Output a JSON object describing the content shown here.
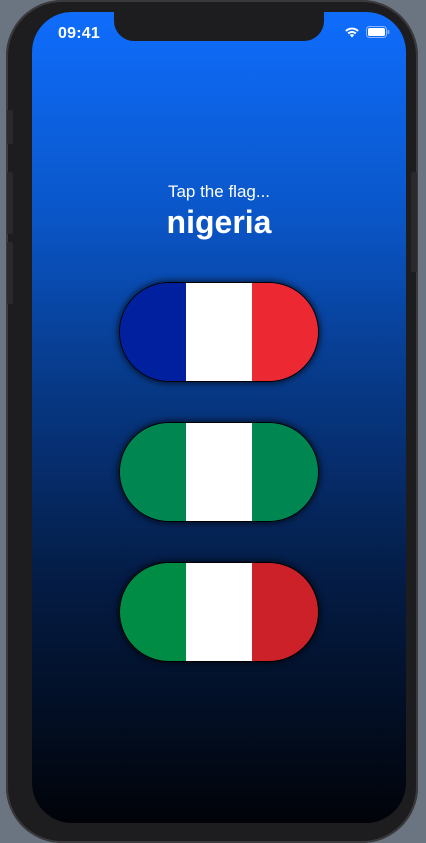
{
  "status_bar": {
    "time": "09:41",
    "icons": [
      "wifi-icon",
      "battery-icon"
    ]
  },
  "game": {
    "prompt": "Tap the flag...",
    "country": "nigeria"
  },
  "flags": [
    {
      "name": "france",
      "stripes": [
        "#00209f",
        "#ffffff",
        "#ec2833"
      ]
    },
    {
      "name": "nigeria",
      "stripes": [
        "#008751",
        "#ffffff",
        "#008751"
      ]
    },
    {
      "name": "italy",
      "stripes": [
        "#008c45",
        "#ffffff",
        "#cd212a"
      ]
    }
  ],
  "colors": {
    "background_top": "#0f6dfc",
    "background_bottom": "#010308",
    "text": "#ffffff"
  }
}
